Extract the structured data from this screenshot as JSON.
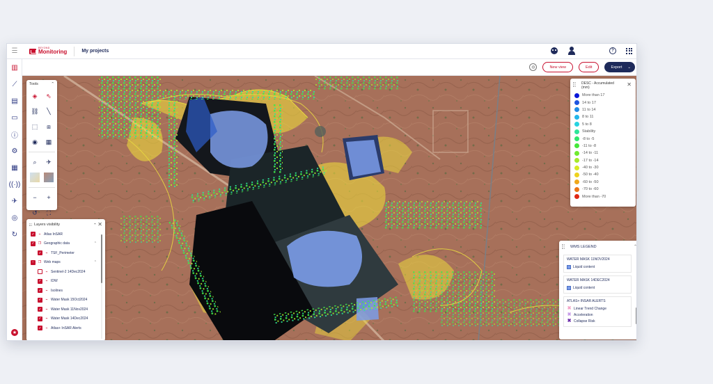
{
  "topbar": {
    "logo_small": "BEYOND",
    "logo_text": "Monitoring",
    "project_link": "My projects"
  },
  "toolbar": {
    "new_view": "New view",
    "edit": "Edit",
    "export": "Export"
  },
  "tools": {
    "title": "Tools"
  },
  "layers": {
    "title": "Layers visibility",
    "items": [
      {
        "label": "Atlas InSAR",
        "state": "checked",
        "indent": 0
      },
      {
        "label": "Geographic data",
        "state": "checked",
        "indent": 0,
        "expand": "up"
      },
      {
        "label": "TSF_Perimeter",
        "state": "checked",
        "indent": 1
      },
      {
        "label": "Web maps",
        "state": "partial",
        "indent": 0,
        "expand": "up"
      },
      {
        "label": "Sentinel-2 14Dec2024",
        "state": "empty",
        "indent": 1
      },
      {
        "label": "IDW",
        "state": "checked",
        "indent": 1
      },
      {
        "label": "Isolines",
        "state": "checked",
        "indent": 1
      },
      {
        "label": "Water Mask 15Oct2024",
        "state": "checked",
        "indent": 1
      },
      {
        "label": "Water Mask 11Nov2024",
        "state": "checked",
        "indent": 1
      },
      {
        "label": "Water Mask 14Dec2024",
        "state": "checked",
        "indent": 1
      },
      {
        "label": "Atlas+ InSAR Alerts",
        "state": "checked",
        "indent": 1
      }
    ]
  },
  "legend": {
    "title": "DESC - Accumulated (mm)",
    "items": [
      {
        "label": "More than 17",
        "color": "#0a16d8"
      },
      {
        "label": "14 to 17",
        "color": "#1e55e0"
      },
      {
        "label": "11 to 14",
        "color": "#1f8be6"
      },
      {
        "label": "8 to 11",
        "color": "#23b7ea"
      },
      {
        "label": "5 to 8",
        "color": "#27d3e0"
      },
      {
        "label": "Stability",
        "color": "#2ee69a"
      },
      {
        "label": "-8 to -5",
        "color": "#2fe86c"
      },
      {
        "label": "-11 to -8",
        "color": "#45e83a"
      },
      {
        "label": "-14 to -11",
        "color": "#72ea2e"
      },
      {
        "label": "-17 to -14",
        "color": "#a6ea2a"
      },
      {
        "label": "-40 to -30",
        "color": "#d8ea22"
      },
      {
        "label": "-50 to -40",
        "color": "#eed21e"
      },
      {
        "label": "-60 to -50",
        "color": "#f0a81a"
      },
      {
        "label": "-70 to -60",
        "color": "#ec7416"
      },
      {
        "label": "More than -70",
        "color": "#e02814"
      }
    ]
  },
  "wms": {
    "title": "WMS LEGEND",
    "sections": [
      {
        "title": "WATER MASK 11NOV2024",
        "items": [
          {
            "label": "Liquid content",
            "icon": "square",
            "color": "#7b9ce8"
          }
        ]
      },
      {
        "title": "WATER MASK 14DEC2024",
        "items": [
          {
            "label": "Liquid content",
            "icon": "square",
            "color": "#7b9ce8"
          }
        ]
      },
      {
        "title": "ATLAS+ INSAR ALERTS",
        "items": [
          {
            "label": "Linear Trend Change",
            "icon": "x",
            "color": "#f5a3c8"
          },
          {
            "label": "Acceleration",
            "icon": "x",
            "color": "#c79be8"
          },
          {
            "label": "Collapse Risk",
            "icon": "x",
            "color": "#6a2aa8"
          }
        ]
      }
    ]
  }
}
